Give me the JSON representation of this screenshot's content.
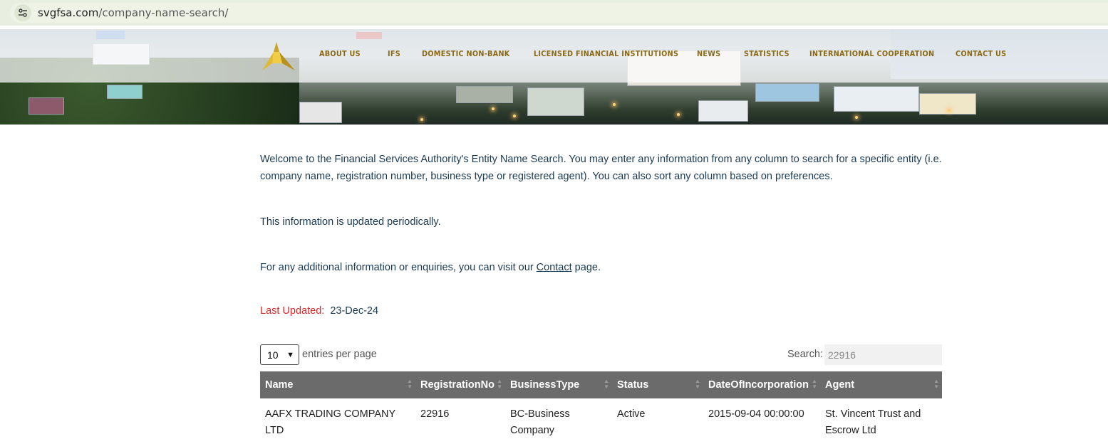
{
  "browser": {
    "url_domain": "svgfsa.com",
    "url_path": "/company-name-search/"
  },
  "nav": {
    "items": [
      {
        "label": "ABOUT US"
      },
      {
        "label": "IFS"
      },
      {
        "label": "DOMESTIC NON-BANK"
      },
      {
        "label": "LICENSED FINANCIAL INSTITUTIONS"
      },
      {
        "label": "NEWS"
      },
      {
        "label": "STATISTICS"
      },
      {
        "label": "INTERNATIONAL COOPERATION"
      },
      {
        "label": "CONTACT US"
      }
    ]
  },
  "intro": {
    "welcome": "Welcome to the Financial Services Authority's Entity Name Search. You may enter any information from any column to search for a specific entity (i.e. company name, registration number, business type or registered agent). You can also sort any column based on preferences.",
    "periodic": "This information is updated periodically.",
    "contact_prefix": "For any additional information or enquiries, you can visit our ",
    "contact_link": "Contact",
    "contact_suffix": " page."
  },
  "updated": {
    "label": "Last Updated:",
    "value": "23-Dec-24"
  },
  "controls": {
    "page_size": "10",
    "entries_label": "entries per page",
    "search_label": "Search:",
    "search_value": "22916"
  },
  "table": {
    "columns": [
      "Name",
      "RegistrationNo",
      "BusinessType",
      "Status",
      "DateOfIncorporation",
      "Agent"
    ],
    "rows": [
      [
        "AAFX TRADING COMPANY LTD",
        "22916",
        "BC-Business Company",
        "Active",
        "2015-09-04 00:00:00",
        "St. Vincent Trust and Escrow Ltd"
      ]
    ]
  },
  "colors": {
    "nav_text": "#8a6a14",
    "body_text": "#1a3a52",
    "last_updated_label": "#d62828",
    "table_header_bg": "#6b6b6b"
  }
}
